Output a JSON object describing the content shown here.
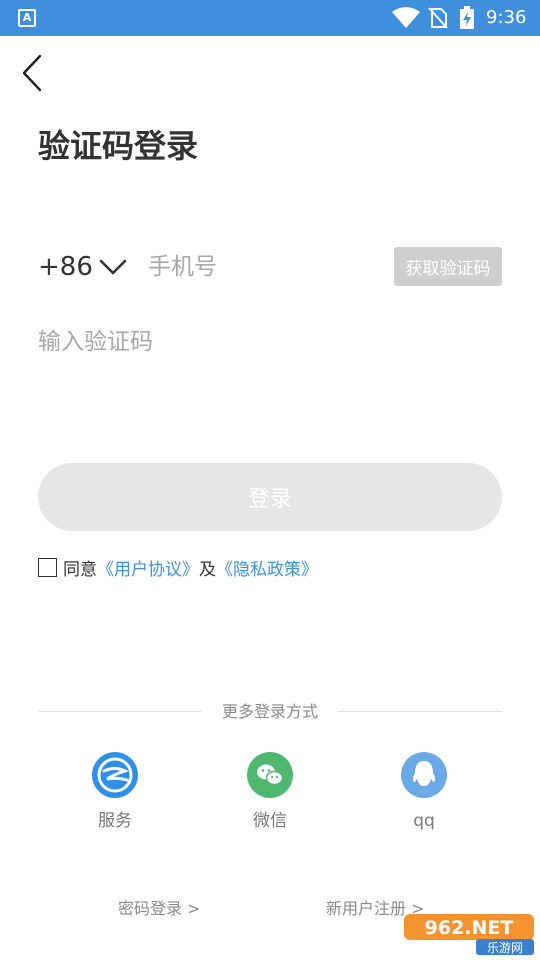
{
  "status_bar": {
    "app_badge": "A",
    "time": "9:36",
    "icons": [
      "app-icon",
      "wifi-icon",
      "no-sim-icon",
      "battery-charging-icon"
    ]
  },
  "header": {
    "back_icon": "chevron-left-icon",
    "title": "验证码登录"
  },
  "form": {
    "country_code": "+86",
    "country_dropdown_icon": "chevron-down-icon",
    "phone_placeholder": "手机号",
    "get_code_label": "获取验证码",
    "code_placeholder": "输入验证码",
    "login_label": "登录"
  },
  "agreement": {
    "prefix": "同意",
    "user_agreement": "《用户协议》",
    "and": "及",
    "privacy_policy": "《隐私政策》"
  },
  "more_login": {
    "label": "更多登录方式",
    "options": [
      {
        "name": "服务",
        "icon": "service-icon",
        "color": "#2f8fe8"
      },
      {
        "name": "微信",
        "icon": "wechat-icon",
        "color": "#4fb86f"
      },
      {
        "name": "qq",
        "icon": "qq-icon",
        "color": "#6aa8e6"
      }
    ]
  },
  "footer": {
    "password_login": "密码登录 >",
    "new_user_register": "新用户注册 >"
  },
  "watermark": {
    "top": "962.NET",
    "bottom": "乐游网"
  },
  "colors": {
    "status_bar": "#3f8fdc",
    "link": "#3f8fdc",
    "button_disabled": "#e6e6e6",
    "get_code_disabled": "#cfcfcf"
  }
}
